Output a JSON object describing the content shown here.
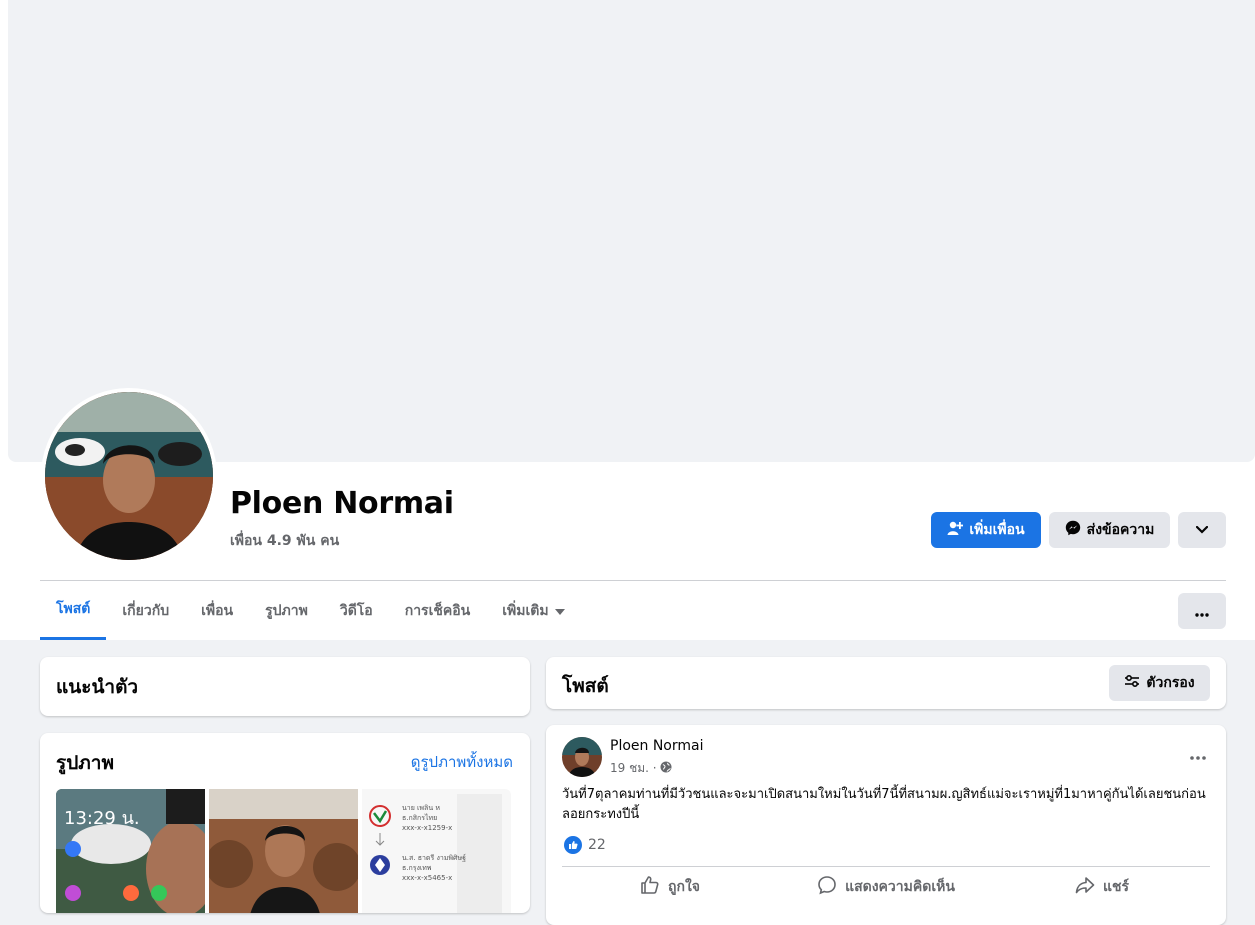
{
  "profile": {
    "name": "Ploen Normai",
    "friends_count": "เพื่อน 4.9 พัน คน"
  },
  "actions": {
    "add_friend": "เพิ่มเพื่อน",
    "message": "ส่งข้อความ"
  },
  "tabs": [
    {
      "label": "โพสต์"
    },
    {
      "label": "เกี่ยวกับ"
    },
    {
      "label": "เพื่อน"
    },
    {
      "label": "รูปภาพ"
    },
    {
      "label": "วิดีโอ"
    },
    {
      "label": "การเช็คอิน"
    },
    {
      "label": "เพิ่มเติม"
    }
  ],
  "intro": {
    "title": "แนะนำตัว"
  },
  "photos": {
    "title": "รูปภาพ",
    "see_all": "ดูรูปภาพทั้งหมด",
    "thumb1_time": "13:29 น.",
    "thumb3_line1": "นาย เพลิน ห",
    "thumb3_line2": "ธ.กสิกรไทย",
    "thumb3_line3": "xxx-x-x1259-x",
    "thumb3_line4": "น.ส. ธาดรี งามพิศิษฐ์",
    "thumb3_line5": "ธ.กรุงเทพ",
    "thumb3_line6": "xxx-x-x5465-x"
  },
  "posts_header": {
    "title": "โพสต์",
    "filter": "ตัวกรอง"
  },
  "post": {
    "author": "Ploen Normai",
    "time": "19 ชม. ·",
    "text": "วันที่7ตุลาคมท่านที่มีวัวชนและจะมาเปิดสนามใหม่ในวันที่7นี้ที่สนามผ.ญสิทธ์แม่จะเราหมู่ที่1มาหาคู่กันได้เลยชนก่อนลอยกระทงปีนี้",
    "likes": "22",
    "like_label": "ถูกใจ",
    "comment_label": "แสดงความคิดเห็น",
    "share_label": "แชร์"
  },
  "colors": {
    "accent": "#1b74e4",
    "background": "#f0f2f5",
    "secondary_text": "#65676b"
  }
}
